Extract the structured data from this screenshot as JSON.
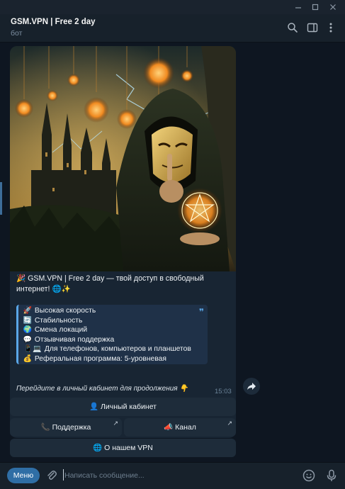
{
  "window": {
    "minimize_icon": "minimize-icon",
    "maximize_icon": "maximize-icon",
    "close_icon": "close-icon"
  },
  "header": {
    "title": "GSM.VPN | Free 2 day",
    "subtitle": "бот"
  },
  "message": {
    "intro_emoji": "🎉",
    "intro_text": "GSM.VPN | Free 2 day — твой доступ в свободный интернет!",
    "intro_suffix": "🌐✨",
    "features": [
      {
        "emoji": "🚀",
        "text": "Высокая скорость"
      },
      {
        "emoji": "🔄",
        "text": "Стабильность"
      },
      {
        "emoji": "🌍",
        "text": "Смена локаций"
      },
      {
        "emoji": "💬",
        "text": "Отзывчивая поддержка"
      },
      {
        "emoji": "📱💻",
        "text": "Для телефонов, компьютеров и планшетов"
      },
      {
        "emoji": "💰",
        "text": "Реферальная программа: 5-уровневая"
      }
    ],
    "prompt_text": "Перейдите в личный кабинет для продолжения",
    "prompt_emoji": "👇",
    "time": "15:03"
  },
  "keyboard": {
    "cabinet": {
      "emoji": "👤",
      "label": "Личный кабинет"
    },
    "support": {
      "emoji": "📞",
      "label": "Поддержка",
      "arrow": "↗"
    },
    "channel": {
      "emoji": "📣",
      "label": "Канал",
      "arrow": "↗"
    },
    "about": {
      "emoji": "🌐",
      "label": "О нашем VPN"
    }
  },
  "composer": {
    "menu_label": "Меню",
    "placeholder": "Написать сообщение..."
  },
  "colors": {
    "background": "#0e1621",
    "bubble": "#182533",
    "accent": "#5aa7e8",
    "menu_button": "#2f6ea5"
  }
}
